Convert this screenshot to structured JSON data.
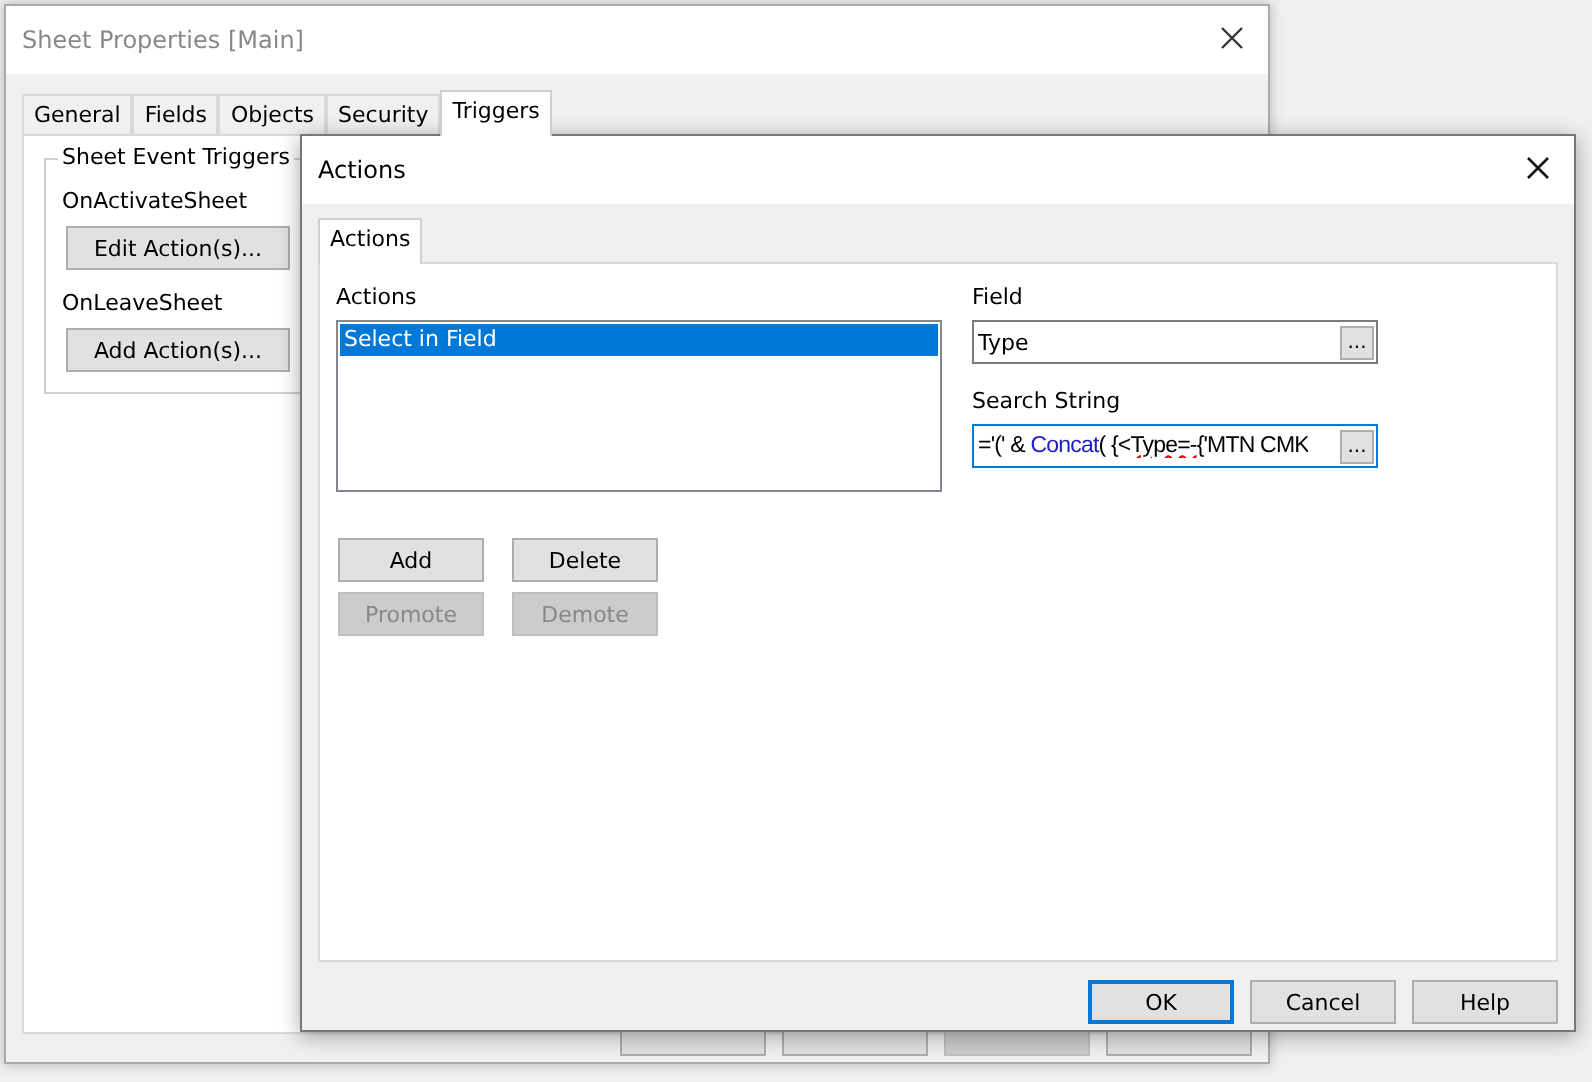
{
  "back_window": {
    "title": "Sheet Properties [Main]",
    "tabs": [
      {
        "label": "General",
        "selected": false
      },
      {
        "label": "Fields",
        "selected": false
      },
      {
        "label": "Objects",
        "selected": false
      },
      {
        "label": "Security",
        "selected": false
      },
      {
        "label": "Triggers",
        "selected": true
      }
    ],
    "group": {
      "title": "Sheet Event Triggers",
      "triggers": [
        {
          "label": "OnActivateSheet",
          "button": "Edit Action(s)..."
        },
        {
          "label": "OnLeaveSheet",
          "button": "Add Action(s)..."
        }
      ]
    },
    "buttons": [
      {
        "disabled": false
      },
      {
        "disabled": false
      },
      {
        "disabled": true
      },
      {
        "disabled": false
      }
    ]
  },
  "dialog": {
    "title": "Actions",
    "tabs": [
      {
        "label": "Actions",
        "selected": true
      }
    ],
    "actions_label": "Actions",
    "actions": [
      {
        "label": "Select in Field",
        "selected": true
      }
    ],
    "action_buttons": [
      {
        "label": "Add",
        "disabled": false
      },
      {
        "label": "Delete",
        "disabled": false
      },
      {
        "label": "Promote",
        "disabled": true
      },
      {
        "label": "Demote",
        "disabled": true
      }
    ],
    "field": {
      "label": "Field",
      "value": "Type",
      "button": "..."
    },
    "search_string": {
      "label": "Search String",
      "focused": true,
      "button": "...",
      "segments": [
        {
          "text": "='(' & ",
          "kind": "plain"
        },
        {
          "text": "Concat",
          "kind": "function"
        },
        {
          "text": "( {<",
          "kind": "plain"
        },
        {
          "text": "Type=-",
          "kind": "misspelled"
        },
        {
          "text": "{'MTN CMK",
          "kind": "plain"
        }
      ]
    },
    "buttons": [
      {
        "label": "OK",
        "default": true
      },
      {
        "label": "Cancel",
        "default": false
      },
      {
        "label": "Help",
        "default": false
      }
    ]
  }
}
